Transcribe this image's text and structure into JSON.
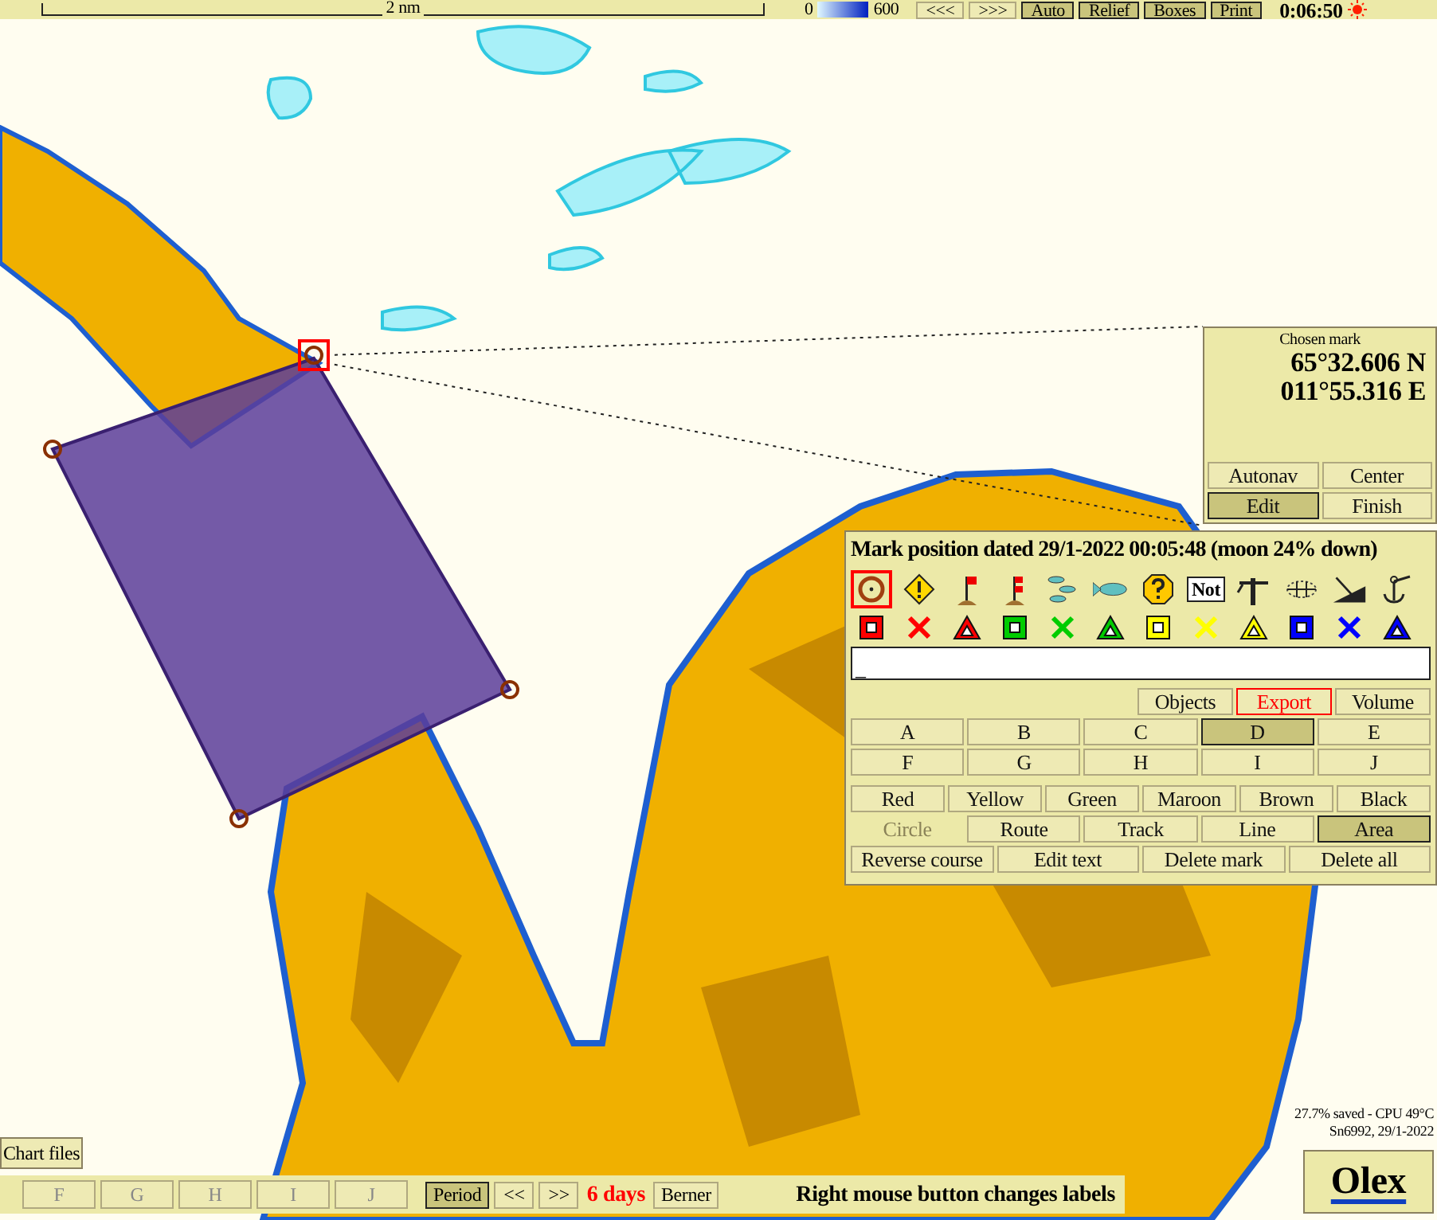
{
  "top_bar": {
    "scale_label": "2 nm",
    "depth_legend": {
      "min": "0",
      "max": "600"
    },
    "buttons": [
      {
        "label": "<<<",
        "pressed": false
      },
      {
        "label": ">>>",
        "pressed": false
      },
      {
        "label": "Auto",
        "pressed": true
      },
      {
        "label": "Relief",
        "pressed": true
      },
      {
        "label": "Boxes",
        "pressed": true
      },
      {
        "label": "Print",
        "pressed": true
      }
    ],
    "time": "0:06:50"
  },
  "chosen_mark": {
    "title": "Chosen mark",
    "latitude": "65°32.606 N",
    "longitude": "011°55.316 E",
    "buttons": [
      {
        "label": "Autonav",
        "selected": false
      },
      {
        "label": "Center",
        "selected": false
      },
      {
        "label": "Edit",
        "selected": true
      },
      {
        "label": "Finish",
        "selected": false
      }
    ]
  },
  "mark_panel": {
    "title": "Mark position dated 29/1-2022 00:05:48 (moon 24% down)",
    "symbols": [
      {
        "kind": "target",
        "selected": true
      },
      {
        "kind": "warning",
        "selected": false
      },
      {
        "kind": "flag",
        "selected": false
      },
      {
        "kind": "flags",
        "selected": false
      },
      {
        "kind": "fish-school",
        "selected": false
      },
      {
        "kind": "fish",
        "selected": false
      },
      {
        "kind": "question",
        "selected": false
      },
      {
        "kind": "not",
        "label": "Not",
        "selected": false
      },
      {
        "kind": "crane",
        "selected": false
      },
      {
        "kind": "crosshair",
        "selected": false
      },
      {
        "kind": "slope",
        "selected": false
      },
      {
        "kind": "anchor",
        "selected": false
      }
    ],
    "markers": [
      {
        "kind": "square",
        "color": "#ff0000"
      },
      {
        "kind": "cross",
        "color": "#ff0000"
      },
      {
        "kind": "triangle",
        "color": "#ff0000"
      },
      {
        "kind": "square",
        "color": "#00cc00"
      },
      {
        "kind": "cross",
        "color": "#00cc00"
      },
      {
        "kind": "triangle",
        "color": "#00cc00"
      },
      {
        "kind": "square",
        "color": "#ffff00"
      },
      {
        "kind": "cross",
        "color": "#ffff00"
      },
      {
        "kind": "triangle",
        "color": "#ffff00"
      },
      {
        "kind": "square",
        "color": "#0000ff"
      },
      {
        "kind": "cross",
        "color": "#0000ff"
      },
      {
        "kind": "triangle",
        "color": "#0000ff"
      }
    ],
    "text_field": {
      "value": "_"
    },
    "tools": [
      {
        "label": "Objects",
        "highlighted": false
      },
      {
        "label": "Export",
        "highlighted": true
      },
      {
        "label": "Volume",
        "highlighted": false
      }
    ],
    "letters": [
      {
        "label": "A",
        "selected": false
      },
      {
        "label": "B",
        "selected": false
      },
      {
        "label": "C",
        "selected": false
      },
      {
        "label": "D",
        "selected": true
      },
      {
        "label": "E",
        "selected": false
      },
      {
        "label": "F",
        "selected": false
      },
      {
        "label": "G",
        "selected": false
      },
      {
        "label": "H",
        "selected": false
      },
      {
        "label": "I",
        "selected": false
      },
      {
        "label": "J",
        "selected": false
      }
    ],
    "colors": [
      {
        "label": "Red",
        "selected": false
      },
      {
        "label": "Yellow",
        "selected": false
      },
      {
        "label": "Green",
        "selected": false
      },
      {
        "label": "Maroon",
        "selected": false
      },
      {
        "label": "Brown",
        "selected": false
      },
      {
        "label": "Black",
        "selected": false
      }
    ],
    "types": [
      {
        "label": "Circle",
        "selected": false,
        "disabled": true
      },
      {
        "label": "Route",
        "selected": false,
        "disabled": false
      },
      {
        "label": "Track",
        "selected": false,
        "disabled": false
      },
      {
        "label": "Line",
        "selected": false,
        "disabled": false
      },
      {
        "label": "Area",
        "selected": true,
        "disabled": false
      }
    ],
    "actions": [
      "Reverse course",
      "Edit text",
      "Delete mark",
      "Delete all"
    ]
  },
  "chart_files_button": "Chart files",
  "bottom_bar": {
    "letters": [
      "F",
      "G",
      "H",
      "I",
      "J"
    ],
    "period": {
      "label": "Period",
      "selected": true
    },
    "nav": [
      "<<",
      ">>"
    ],
    "days": "6 days",
    "place": "Berner",
    "hint": "Right mouse button changes labels"
  },
  "status": [
    "27.7% saved - CPU 49°C",
    "Sn6992, 29/1-2022"
  ],
  "logo": "Olex"
}
